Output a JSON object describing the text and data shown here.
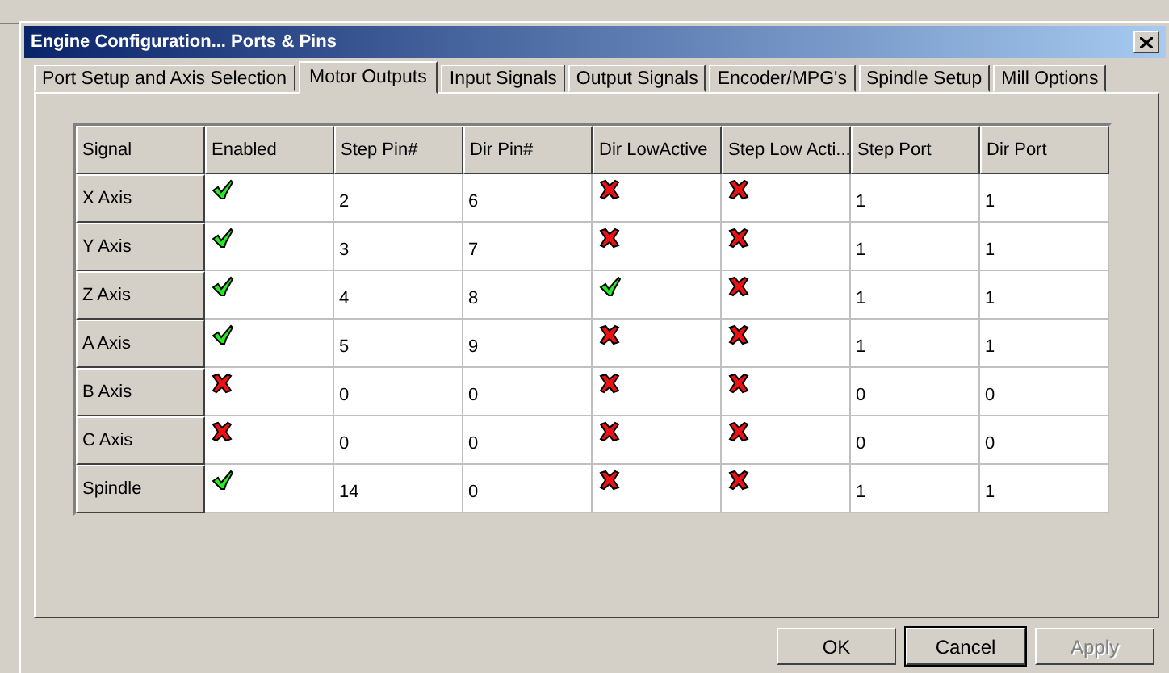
{
  "window": {
    "title": "Engine Configuration... Ports & Pins"
  },
  "tabs": [
    {
      "label": "Port Setup and Axis Selection",
      "selected": false
    },
    {
      "label": "Motor Outputs",
      "selected": true
    },
    {
      "label": "Input Signals",
      "selected": false
    },
    {
      "label": "Output Signals",
      "selected": false
    },
    {
      "label": "Encoder/MPG's",
      "selected": false
    },
    {
      "label": "Spindle Setup",
      "selected": false
    },
    {
      "label": "Mill Options",
      "selected": false
    }
  ],
  "table": {
    "columns": [
      "Signal",
      "Enabled",
      "Step Pin#",
      "Dir Pin#",
      "Dir LowActive",
      "Step Low Acti...",
      "Step Port",
      "Dir Port"
    ],
    "rows": [
      {
        "signal": "X Axis",
        "enabled": true,
        "step_pin": "2",
        "dir_pin": "6",
        "dir_low_active": false,
        "step_low_active": false,
        "step_port": "1",
        "dir_port": "1"
      },
      {
        "signal": "Y Axis",
        "enabled": true,
        "step_pin": "3",
        "dir_pin": "7",
        "dir_low_active": false,
        "step_low_active": false,
        "step_port": "1",
        "dir_port": "1"
      },
      {
        "signal": "Z Axis",
        "enabled": true,
        "step_pin": "4",
        "dir_pin": "8",
        "dir_low_active": true,
        "step_low_active": false,
        "step_port": "1",
        "dir_port": "1"
      },
      {
        "signal": "A Axis",
        "enabled": true,
        "step_pin": "5",
        "dir_pin": "9",
        "dir_low_active": false,
        "step_low_active": false,
        "step_port": "1",
        "dir_port": "1"
      },
      {
        "signal": "B Axis",
        "enabled": false,
        "step_pin": "0",
        "dir_pin": "0",
        "dir_low_active": false,
        "step_low_active": false,
        "step_port": "0",
        "dir_port": "0"
      },
      {
        "signal": "C Axis",
        "enabled": false,
        "step_pin": "0",
        "dir_pin": "0",
        "dir_low_active": false,
        "step_low_active": false,
        "step_port": "0",
        "dir_port": "0"
      },
      {
        "signal": "Spindle",
        "enabled": true,
        "step_pin": "14",
        "dir_pin": "0",
        "dir_low_active": false,
        "step_low_active": false,
        "step_port": "1",
        "dir_port": "1"
      }
    ]
  },
  "buttons": [
    {
      "label": "OK",
      "disabled": false
    },
    {
      "label": "Cancel",
      "disabled": false
    },
    {
      "label": "Apply",
      "disabled": true
    }
  ]
}
